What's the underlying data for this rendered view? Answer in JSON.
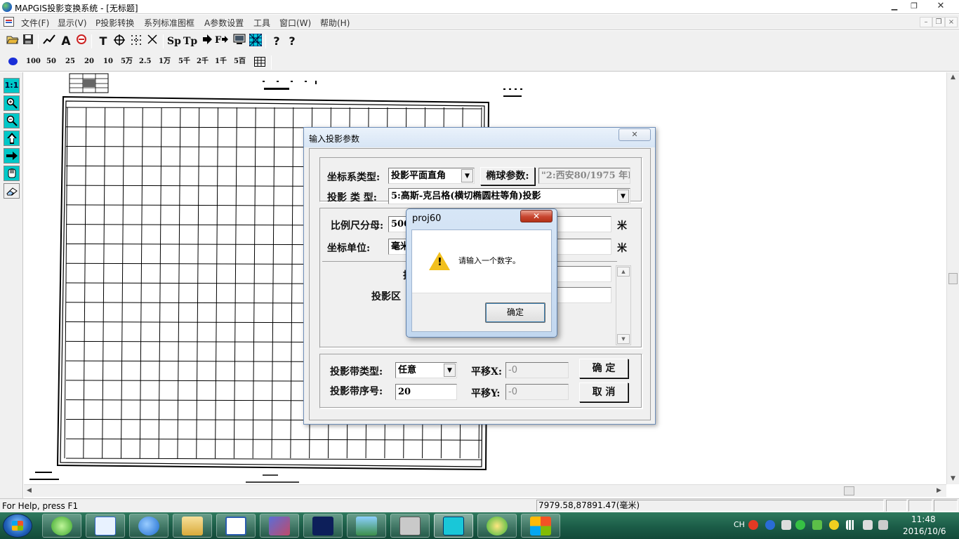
{
  "window": {
    "title": "MAPGIS投影变换系统 - [无标题]",
    "min": "▁",
    "max": "❐",
    "close": "✕"
  },
  "menu": {
    "items": [
      "文件(F)",
      "显示(V)",
      "P投影转换",
      "系列标准图框",
      "A参数设置",
      "工具",
      "窗口(W)",
      "帮助(H)"
    ],
    "mdi_min": "–",
    "mdi_restore": "❐",
    "mdi_close": "×"
  },
  "toolbar1": {
    "text_tool": "T",
    "sp": "Sp",
    "tp": "Tp",
    "help": "?",
    "whatsthis": "?"
  },
  "toolbar2": {
    "scales": [
      "100",
      "50",
      "25",
      "20",
      "10",
      "5万",
      "2.5",
      "1万",
      "5千",
      "2千",
      "1千",
      "5百"
    ]
  },
  "leftpanel": {
    "one_to_one": "1:1"
  },
  "status": {
    "help": "For Help, press F1",
    "coord": "7979.58,87891.47(毫米)"
  },
  "dialog": {
    "title": "输入投影参数",
    "close": "✕",
    "coord_type_label": "坐标系类型:",
    "coord_type_value": "投影平面直角",
    "ellipsoid_button": "椭球参数:",
    "ellipsoid_value": "\"2:西安80/1975 年I",
    "proj_type_label": "投影 类 型:",
    "proj_type_value": "5:高斯-克吕格(横切椭圆柱等角)投影",
    "scale_label": "比例尺分母:",
    "scale_value": "500",
    "unit_label": "坐标单位:",
    "unit_value": "毫米",
    "unit_suffix_1": "米",
    "unit_suffix_2": "米",
    "hidden_label_1": "投",
    "zone_label": "投影区",
    "band_type_label": "投影带类型:",
    "band_type_value": "任意",
    "band_no_label": "投影带序号:",
    "band_no_value": "20",
    "shift_x_label": "平移X:",
    "shift_x_value": "-0",
    "shift_y_label": "平移Y:",
    "shift_y_value": "-0",
    "ok": "确 定",
    "cancel": "取 消"
  },
  "msgbox": {
    "title": "proj60",
    "text": "请输入一个数字。",
    "ok": "确定",
    "warn_mark": "!"
  },
  "taskbar": {
    "lang": "CH",
    "time": "11:48",
    "date": "2016/10/6"
  }
}
